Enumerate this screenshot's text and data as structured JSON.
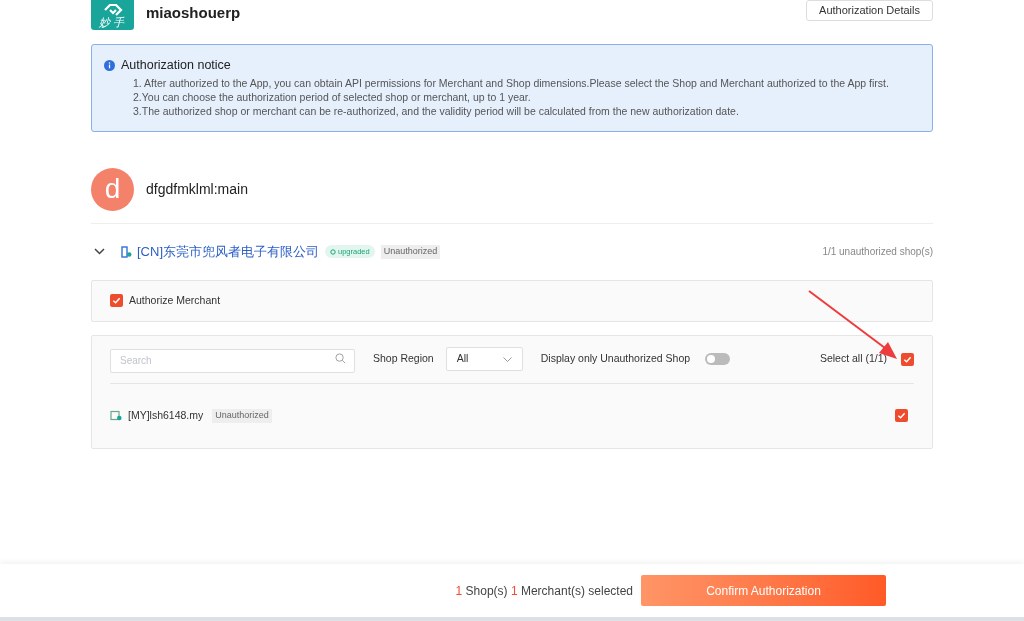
{
  "app": {
    "logo_text": "妙手",
    "name": "miaoshouerp",
    "details_button": "Authorization Details"
  },
  "notice": {
    "title": "Authorization notice",
    "lines": [
      "1. After authorized to the App, you can obtain API permissions for Merchant and Shop dimensions.Please select the Shop and Merchant authorized to the App first.",
      "2.You can choose the authorization period of selected shop or merchant, up to 1 year.",
      "3.The authorized shop or merchant can be re-authorized, and the validity period will be calculated from the new authorization date."
    ]
  },
  "account": {
    "avatar_letter": "d",
    "name": "dfgdfmklml:main"
  },
  "merchant": {
    "expanded": true,
    "name": "[CN]东莞市兜风者电子有限公司",
    "badge": "upgraded",
    "status": "Unauthorized",
    "summary": "1/1 unauthorized shop(s)"
  },
  "authorize_merchant": {
    "label": "Authorize Merchant",
    "checked": true
  },
  "filters": {
    "search_placeholder": "Search",
    "region_label": "Shop Region",
    "region_value": "All",
    "toggle_label": "Display only Unauthorized Shop",
    "toggle_on": false,
    "select_all_label": "Select all (1/1)",
    "select_all_checked": true
  },
  "shops": [
    {
      "name": "[MY]lsh6148.my",
      "status": "Unauthorized",
      "checked": true
    }
  ],
  "footer": {
    "shop_count": "1",
    "shop_label": "Shop(s)",
    "merchant_count": "1",
    "merchant_label": "Merchant(s) selected",
    "confirm_button": "Confirm Authorization"
  }
}
